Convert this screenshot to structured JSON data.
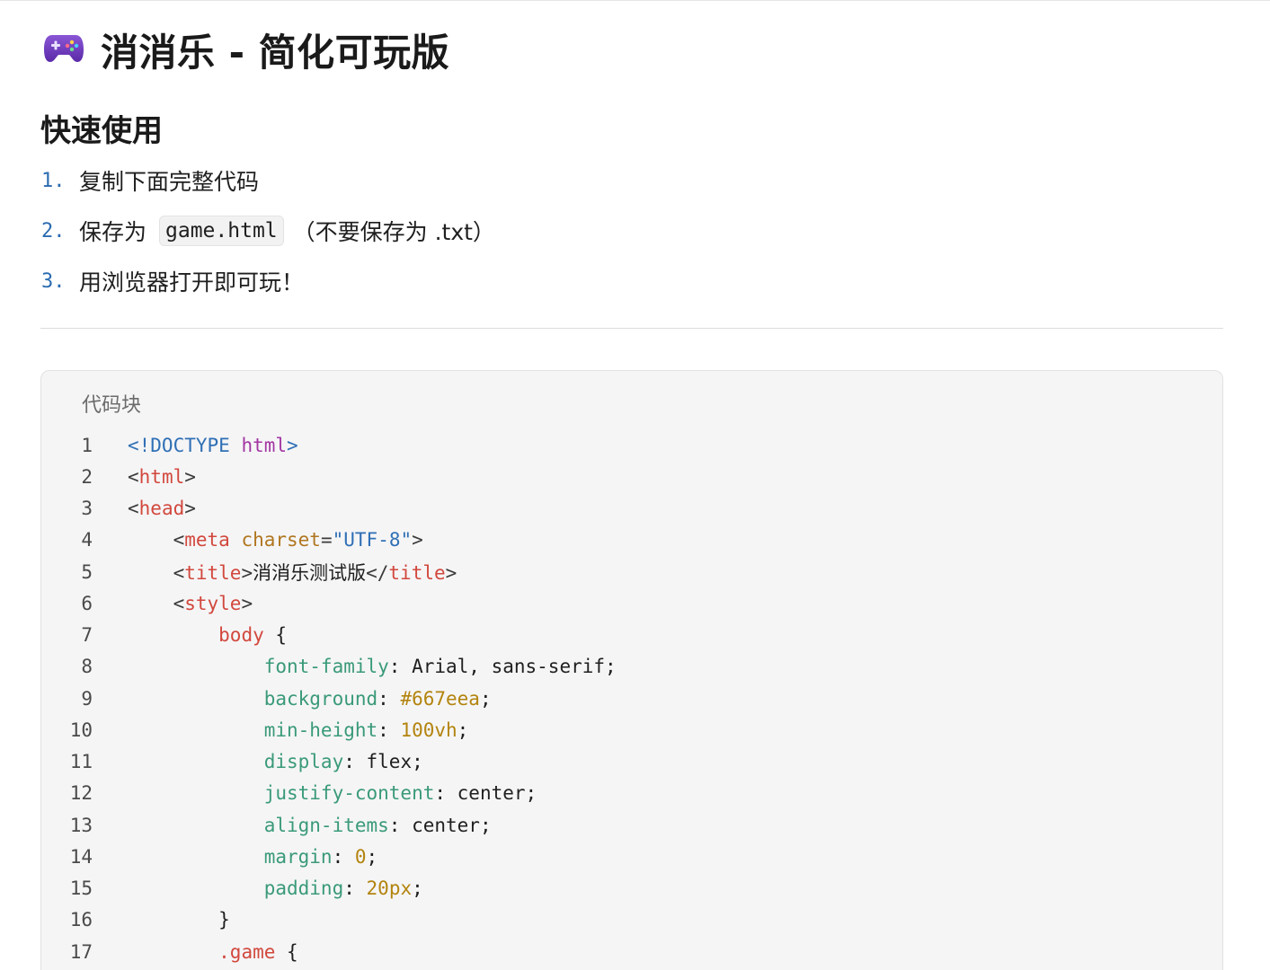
{
  "header": {
    "icon": "game-controller-icon",
    "title": "消消乐 - 简化可玩版"
  },
  "quick_start": {
    "heading": "快速使用",
    "steps": [
      {
        "num": "1.",
        "text": "复制下面完整代码"
      },
      {
        "num": "2.",
        "text_before": "保存为",
        "code": "game.html",
        "text_after": "（不要保存为 .txt）"
      },
      {
        "num": "3.",
        "text": "用浏览器打开即可玩！"
      }
    ]
  },
  "code_block": {
    "label": "代码块",
    "lines": [
      {
        "n": "1",
        "tokens": [
          [
            "tk-doc",
            "<!DOCTYPE "
          ],
          [
            "tk-html",
            "html"
          ],
          [
            "tk-doc",
            ">"
          ]
        ]
      },
      {
        "n": "2",
        "tokens": [
          [
            "tk-punc",
            "<"
          ],
          [
            "tk-tag",
            "html"
          ],
          [
            "tk-punc",
            ">"
          ]
        ]
      },
      {
        "n": "3",
        "tokens": [
          [
            "tk-punc",
            "<"
          ],
          [
            "tk-tag",
            "head"
          ],
          [
            "tk-punc",
            ">"
          ]
        ]
      },
      {
        "n": "4",
        "tokens": [
          [
            "tk-text",
            "    "
          ],
          [
            "tk-punc",
            "<"
          ],
          [
            "tk-tag",
            "meta "
          ],
          [
            "tk-attr",
            "charset"
          ],
          [
            "tk-punc",
            "="
          ],
          [
            "tk-str",
            "\"UTF-8\""
          ],
          [
            "tk-punc",
            ">"
          ]
        ]
      },
      {
        "n": "5",
        "tokens": [
          [
            "tk-text",
            "    "
          ],
          [
            "tk-punc",
            "<"
          ],
          [
            "tk-tag",
            "title"
          ],
          [
            "tk-punc",
            ">"
          ],
          [
            "tk-text",
            "消消乐测试版"
          ],
          [
            "tk-punc",
            "</"
          ],
          [
            "tk-tag",
            "title"
          ],
          [
            "tk-punc",
            ">"
          ]
        ]
      },
      {
        "n": "6",
        "tokens": [
          [
            "tk-text",
            "    "
          ],
          [
            "tk-punc",
            "<"
          ],
          [
            "tk-tag",
            "style"
          ],
          [
            "tk-punc",
            ">"
          ]
        ]
      },
      {
        "n": "7",
        "tokens": [
          [
            "tk-text",
            "        "
          ],
          [
            "tk-sel",
            "body"
          ],
          [
            "tk-text",
            " {"
          ]
        ]
      },
      {
        "n": "8",
        "tokens": [
          [
            "tk-text",
            "            "
          ],
          [
            "tk-prop",
            "font-family"
          ],
          [
            "tk-text",
            ": Arial, sans-serif;"
          ]
        ]
      },
      {
        "n": "9",
        "tokens": [
          [
            "tk-text",
            "            "
          ],
          [
            "tk-prop",
            "background"
          ],
          [
            "tk-text",
            ": "
          ],
          [
            "tk-num",
            "#667eea"
          ],
          [
            "tk-text",
            ";"
          ]
        ]
      },
      {
        "n": "10",
        "tokens": [
          [
            "tk-text",
            "            "
          ],
          [
            "tk-prop",
            "min-height"
          ],
          [
            "tk-text",
            ": "
          ],
          [
            "tk-num",
            "100vh"
          ],
          [
            "tk-text",
            ";"
          ]
        ]
      },
      {
        "n": "11",
        "tokens": [
          [
            "tk-text",
            "            "
          ],
          [
            "tk-prop",
            "display"
          ],
          [
            "tk-text",
            ": flex;"
          ]
        ]
      },
      {
        "n": "12",
        "tokens": [
          [
            "tk-text",
            "            "
          ],
          [
            "tk-prop",
            "justify-content"
          ],
          [
            "tk-text",
            ": center;"
          ]
        ]
      },
      {
        "n": "13",
        "tokens": [
          [
            "tk-text",
            "            "
          ],
          [
            "tk-prop",
            "align-items"
          ],
          [
            "tk-text",
            ": center;"
          ]
        ]
      },
      {
        "n": "14",
        "tokens": [
          [
            "tk-text",
            "            "
          ],
          [
            "tk-prop",
            "margin"
          ],
          [
            "tk-text",
            ": "
          ],
          [
            "tk-num",
            "0"
          ],
          [
            "tk-text",
            ";"
          ]
        ]
      },
      {
        "n": "15",
        "tokens": [
          [
            "tk-text",
            "            "
          ],
          [
            "tk-prop",
            "padding"
          ],
          [
            "tk-text",
            ": "
          ],
          [
            "tk-num",
            "20px"
          ],
          [
            "tk-text",
            ";"
          ]
        ]
      },
      {
        "n": "16",
        "tokens": [
          [
            "tk-text",
            "        }"
          ]
        ]
      },
      {
        "n": "17",
        "tokens": [
          [
            "tk-text",
            "        "
          ],
          [
            "tk-sel",
            ".game"
          ],
          [
            "tk-text",
            " {"
          ]
        ]
      }
    ]
  }
}
